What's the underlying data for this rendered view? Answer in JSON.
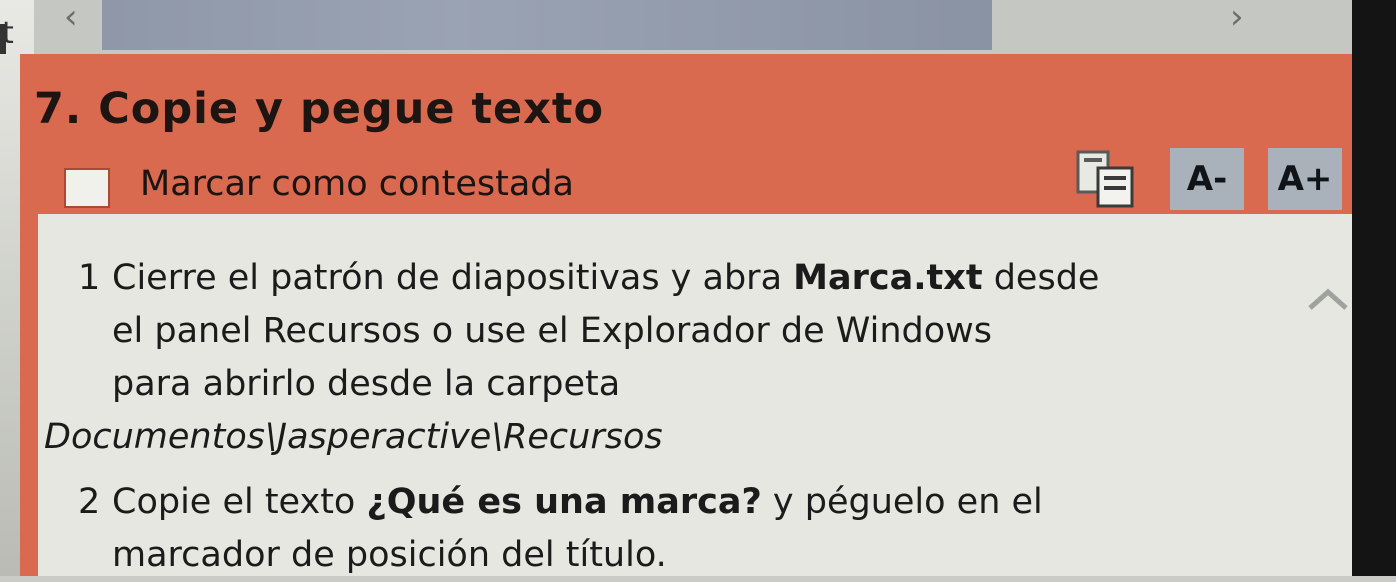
{
  "nav": {
    "prev_glyph": "‹",
    "next_glyph": "›"
  },
  "left_edge_text": "t",
  "question": {
    "title": "7. Copie y pegue texto",
    "mark_label": "Marcar como contestada",
    "font_decrease": "A-",
    "font_increase": "A+",
    "copy_icon": "copy-paste-icon"
  },
  "steps": [
    {
      "number": "1",
      "line1_pre": "Cierre el patrón de diapositivas y abra ",
      "line1_bold": "Marca.txt",
      "line1_post": " desde",
      "line2": "el panel Recursos o use el Explorador de Windows",
      "line3": "para abrirlo desde la carpeta",
      "line4_italic": "Documentos\\Jasperactive\\Recursos"
    },
    {
      "number": "2",
      "line1_pre": "Copie el texto ",
      "line1_bold": "¿Qué es una marca?",
      "line1_post": " y péguelo en el",
      "line2": "marcador de posición del título."
    }
  ],
  "colors": {
    "panel": "#d9694f",
    "content": "#e6e7e1",
    "font_button": "#a9b2ba"
  }
}
